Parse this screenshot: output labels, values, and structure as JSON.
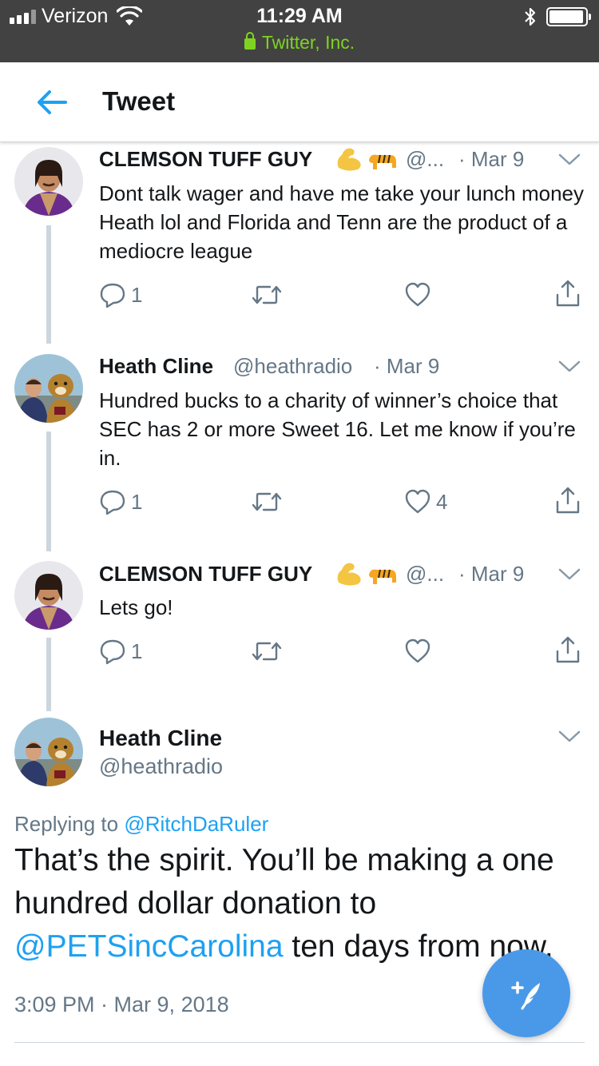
{
  "status_bar": {
    "carrier": "Verizon",
    "time": "11:29 AM",
    "site": "Twitter, Inc."
  },
  "header": {
    "title": "Tweet"
  },
  "thread": [
    {
      "name": "CLEMSON TUFF GUY",
      "handle": "@...",
      "date": "· Mar 9",
      "text": "Dont talk wager and have me take your lunch money Heath lol and Florida and Tenn are the product of a mediocre league",
      "replies": "1",
      "retweets": "",
      "likes": ""
    },
    {
      "name": "Heath Cline",
      "handle": "@heathradio",
      "date": "· Mar 9",
      "text": "Hundred bucks to a charity of winner’s choice that SEC has 2 or more Sweet 16. Let me know if you’re in.",
      "replies": "1",
      "retweets": "",
      "likes": "4"
    },
    {
      "name": "CLEMSON TUFF GUY",
      "handle": "@...",
      "date": "· Mar 9",
      "text": "Lets go!",
      "replies": "1",
      "retweets": "",
      "likes": ""
    }
  ],
  "main_tweet": {
    "name": "Heath Cline",
    "handle": "@heathradio",
    "replying_prefix": "Replying to",
    "replying_to": "@RitchDaRuler",
    "text_before": "That’s the spirit. You’ll be making a one hundred dollar donation to",
    "mention": "@PETSincCarolina",
    "text_after": "ten days from now.",
    "timestamp": "3:09 PM · Mar 9, 2018"
  },
  "icons": {
    "back": "arrow-left-icon",
    "compose": "compose-tweet-icon",
    "reply": "reply-icon",
    "retweet": "retweet-icon",
    "like": "heart-icon",
    "share": "share-icon",
    "more": "chevron-down-icon"
  },
  "colors": {
    "accent": "#1da1f2",
    "secondary_text": "#657786",
    "status_bar": "#424242",
    "secure_lock": "#7ed321",
    "fab": "#4a99e9"
  }
}
